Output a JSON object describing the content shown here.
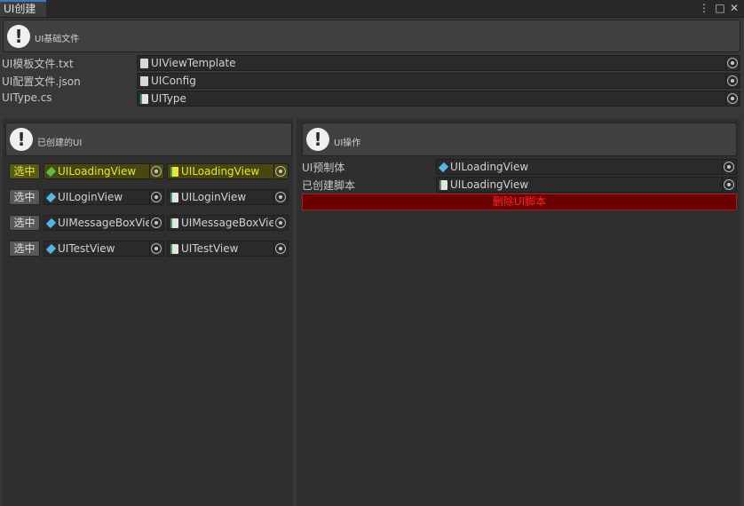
{
  "window": {
    "tab_title": "UI创建",
    "menu_icon": "⋮",
    "maximize_icon": "□",
    "close_icon": "✕"
  },
  "base_files": {
    "help_text": "UI基础文件",
    "rows": [
      {
        "label": "UI模板文件.txt",
        "value": "UIViewTemplate",
        "icon": "text-asset-icon"
      },
      {
        "label": "UI配置文件.json",
        "value": "UIConfig",
        "icon": "text-asset-icon"
      },
      {
        "label": "UIType.cs",
        "value": "UIType",
        "icon": "script-icon"
      }
    ]
  },
  "created_ui": {
    "help_text": "已创建的UI",
    "select_label": "选中",
    "items": [
      {
        "prefab": "UILoadingView",
        "script": "UILoadingView",
        "selected": true
      },
      {
        "prefab": "UILoginView",
        "script": "UILoginView",
        "selected": false
      },
      {
        "prefab": "UIMessageBoxVie",
        "script": "UIMessageBoxVie",
        "selected": false
      },
      {
        "prefab": "UITestView",
        "script": "UITestView",
        "selected": false
      }
    ]
  },
  "ui_ops": {
    "help_text": "UI操作",
    "prefab_label": "UI预制体",
    "prefab_value": "UILoadingView",
    "script_label": "已创建脚本",
    "script_value": "UILoadingView",
    "delete_label": "删除UI脚本"
  },
  "colors": {
    "accent": "#3a79bb",
    "highlight_text": "#e5e53a",
    "danger": "#ff2525",
    "danger_bg": "#6b0000"
  }
}
